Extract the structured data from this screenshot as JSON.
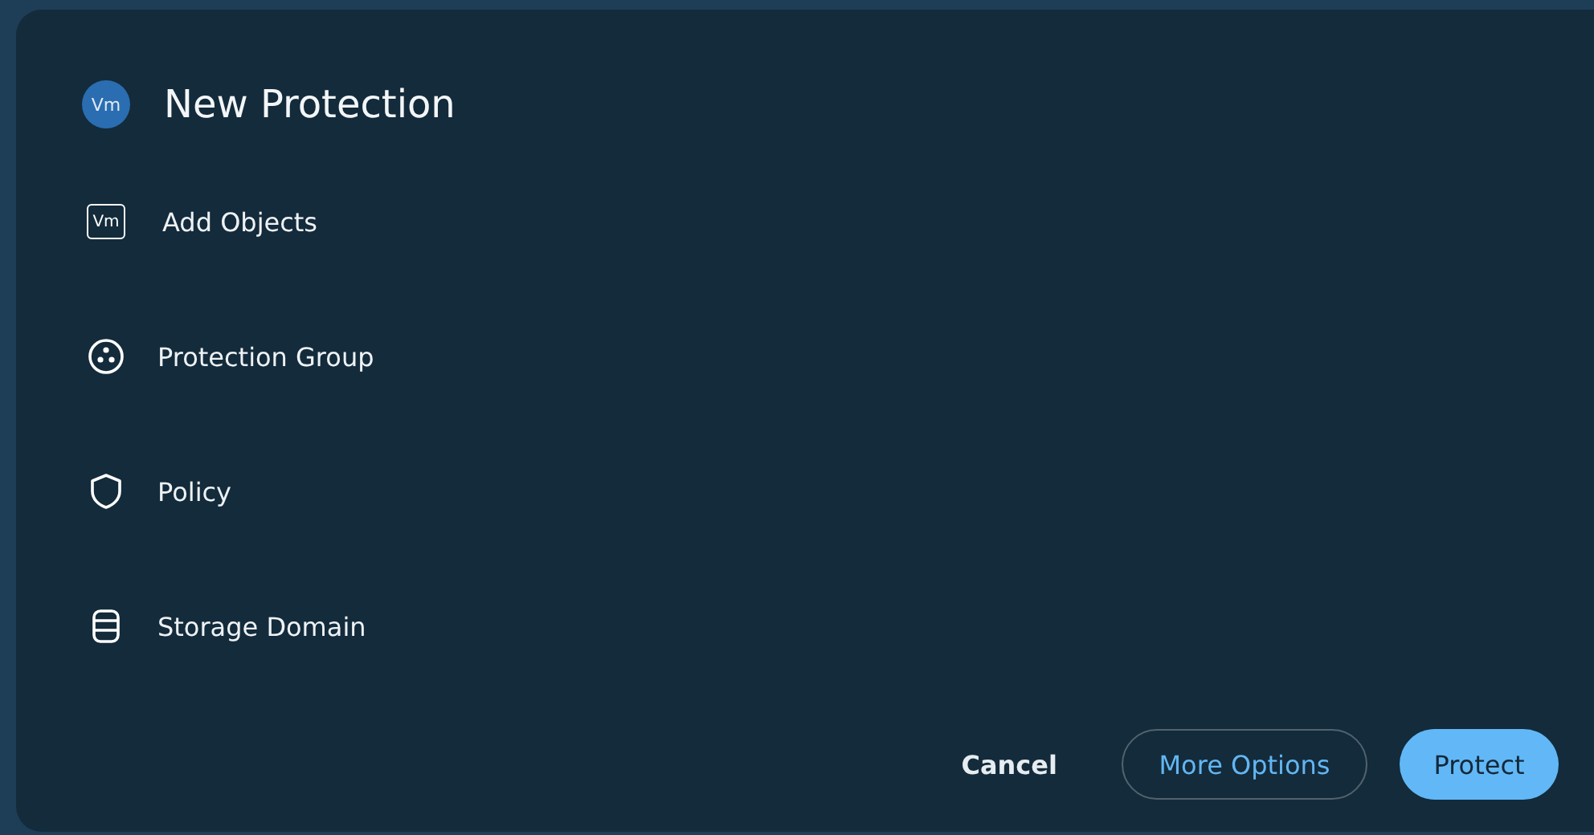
{
  "dialog": {
    "title": "New Protection",
    "badge": "Vm"
  },
  "items": [
    {
      "kind": "vm",
      "label": "Add Objects",
      "icon_text": "Vm"
    },
    {
      "kind": "group",
      "label": "Protection Group"
    },
    {
      "kind": "policy",
      "label": "Policy"
    },
    {
      "kind": "storage",
      "label": "Storage Domain"
    }
  ],
  "buttons": [
    {
      "kind": "text",
      "label": "Cancel"
    },
    {
      "kind": "outline",
      "label": "More Options"
    },
    {
      "kind": "primary",
      "label": "Protect"
    }
  ]
}
